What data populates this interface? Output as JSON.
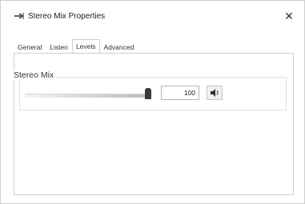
{
  "window": {
    "title": "Stereo Mix Properties",
    "close_glyph": "✕"
  },
  "tabs": [
    {
      "label": "General",
      "active": false
    },
    {
      "label": "Listen",
      "active": false
    },
    {
      "label": "Levels",
      "active": true
    },
    {
      "label": "Advanced",
      "active": false
    }
  ],
  "levels": {
    "group_label": "Stereo Mix",
    "slider_value_percent": 100,
    "value_text": "100",
    "speaker_icon": "speaker-icon"
  }
}
